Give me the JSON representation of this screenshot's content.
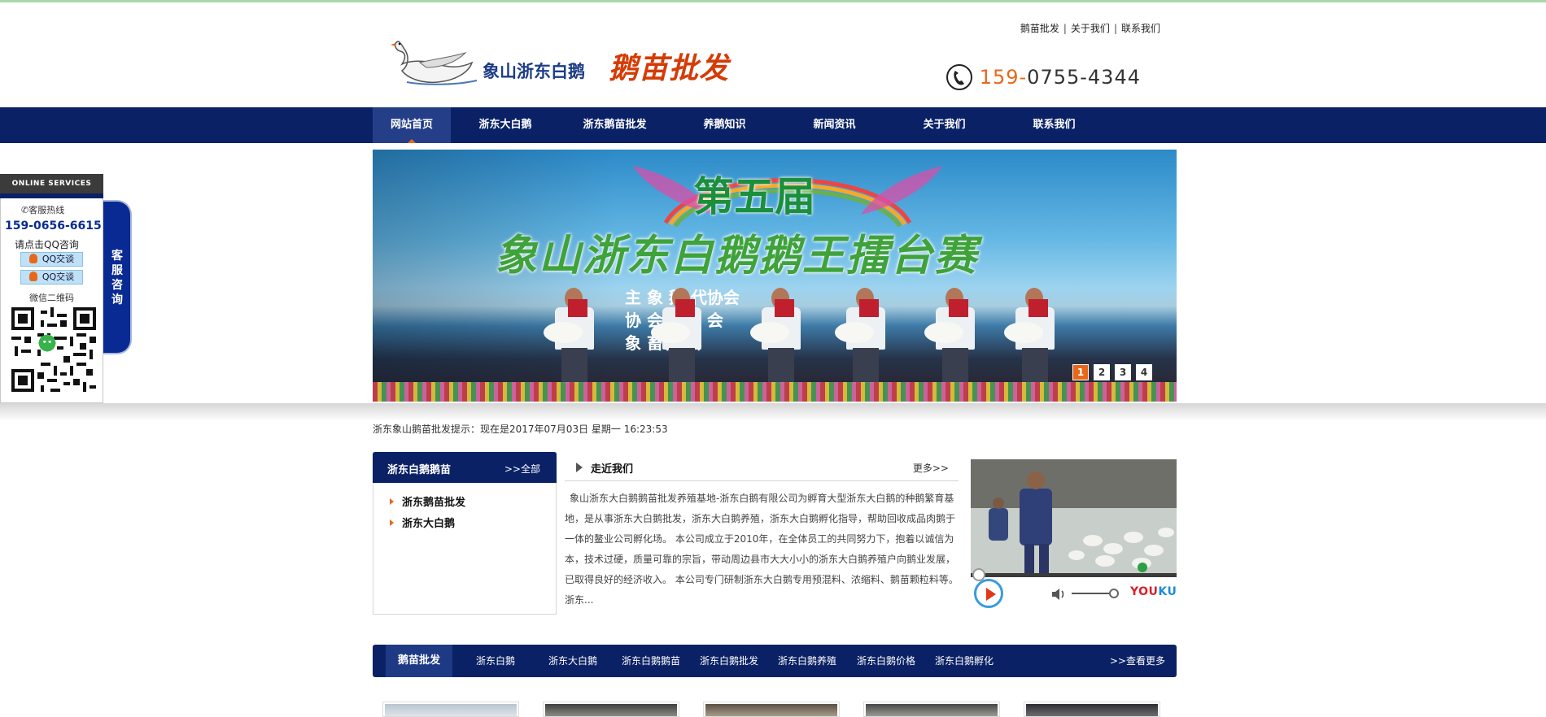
{
  "header": {
    "logo_name": "象山浙东白鹅",
    "logo_slogan": "鹅苗批发",
    "top_links": [
      "鹅苗批发",
      "关于我们",
      "联系我们"
    ],
    "phone_prefix": "159-",
    "phone_rest": "0755-4344"
  },
  "nav": {
    "items": [
      "网站首页",
      "浙东大白鹅",
      "浙东鹅苗批发",
      "养鹅知识",
      "新闻资讯",
      "关于我们",
      "联系我们"
    ]
  },
  "banner": {
    "title1": "第五届",
    "title2": "象山浙东白鹅鹅王擂台赛",
    "sub_line1": "主  象    鹅      代协会",
    "sub_line2": "协    会    科学    会",
    "sub_line3": "象      畜牧    会",
    "slides": [
      "1",
      "2",
      "3",
      "4"
    ],
    "active_slide": "1"
  },
  "service": {
    "head": "ONLINE SERVICES",
    "hotline_label": "客服热线",
    "hotline": "159-0656-6615",
    "qq_tip": "请点击QQ咨询",
    "qq_buttons": [
      "QQ交谈",
      "QQ交谈"
    ],
    "wechat_label": "微信二维码",
    "tab_label": "客服咨询"
  },
  "tip": "浙东象山鹅苗批发提示：现在是2017年07月03日 星期一 16:23:53",
  "category": {
    "title": "浙东白鹅鹅苗",
    "more": ">>全部",
    "items": [
      "浙东鹅苗批发",
      "浙东大白鹅"
    ]
  },
  "about": {
    "title": "走近我们",
    "more": "更多>>",
    "text": "象山浙东大白鹅鹅苗批发养殖基地-浙东白鹅有限公司为孵育大型浙东大白鹅的种鹅繁育基地，是从事浙东大白鹅批发，浙东大白鹅养殖，浙东大白鹅孵化指导，帮助回收成品肉鹅于一体的鳌业公司孵化场。 本公司成立于2010年，在全体员工的共同努力下，抱着以诚信为本，技术过硬，质量可靠的宗旨，带动周边县市大大小小的浙东大白鹅养殖户向鹅业发展，已取得良好的经济收入。 本公司专门研制浙东大白鹅专用预混料、浓缩料、鹅苗颗粒料等。浙东..."
  },
  "video": {
    "brand_you": "YOU",
    "brand_ku": "KU"
  },
  "product_bar": {
    "items": [
      "鹅苗批发",
      "浙东白鹅",
      "浙东大白鹅",
      "浙东白鹅鹅苗",
      "浙东白鹅批发",
      "浙东白鹅养殖",
      "浙东白鹅价格",
      "浙东白鹅孵化"
    ],
    "more": ">>查看更多"
  },
  "colors": {
    "nav_bg": "#0a2166",
    "accent": "#e8681a",
    "logo_blue": "#1d3d86",
    "slogan_red": "#d53b06"
  }
}
